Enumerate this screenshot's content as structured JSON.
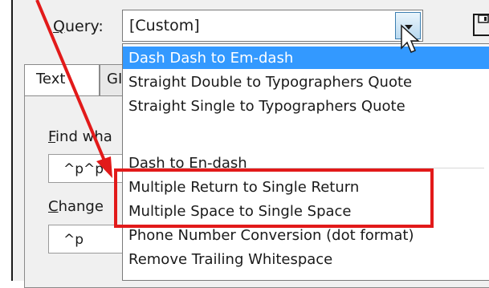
{
  "query": {
    "label_mnemonic": "Q",
    "label_rest": "uery:",
    "selected_value": "[Custom]",
    "options": [
      "Dash Dash to Em-dash",
      "Straight Double to Typographers Quote",
      "Straight Single to Typographers Quote",
      "Dash to En-dash",
      "Multiple Return to Single Return",
      "Multiple Space to Single Space",
      "Phone Number Conversion (dot format)",
      "Remove Trailing Whitespace"
    ],
    "selected_index": 0
  },
  "tabs": {
    "text": "Text",
    "grep": "GI"
  },
  "find": {
    "label_mnemonic": "F",
    "label_rest": "ind wha",
    "value": "^p^p"
  },
  "change": {
    "label_mnemonic": "C",
    "label_rest": "hange",
    "value": "^p"
  },
  "colors": {
    "annotation": "#e21a1a",
    "selection": "#3399ff"
  },
  "icons": [
    "save-icon",
    "chevron-down-icon",
    "mouse-cursor-icon",
    "annotation-arrow"
  ]
}
